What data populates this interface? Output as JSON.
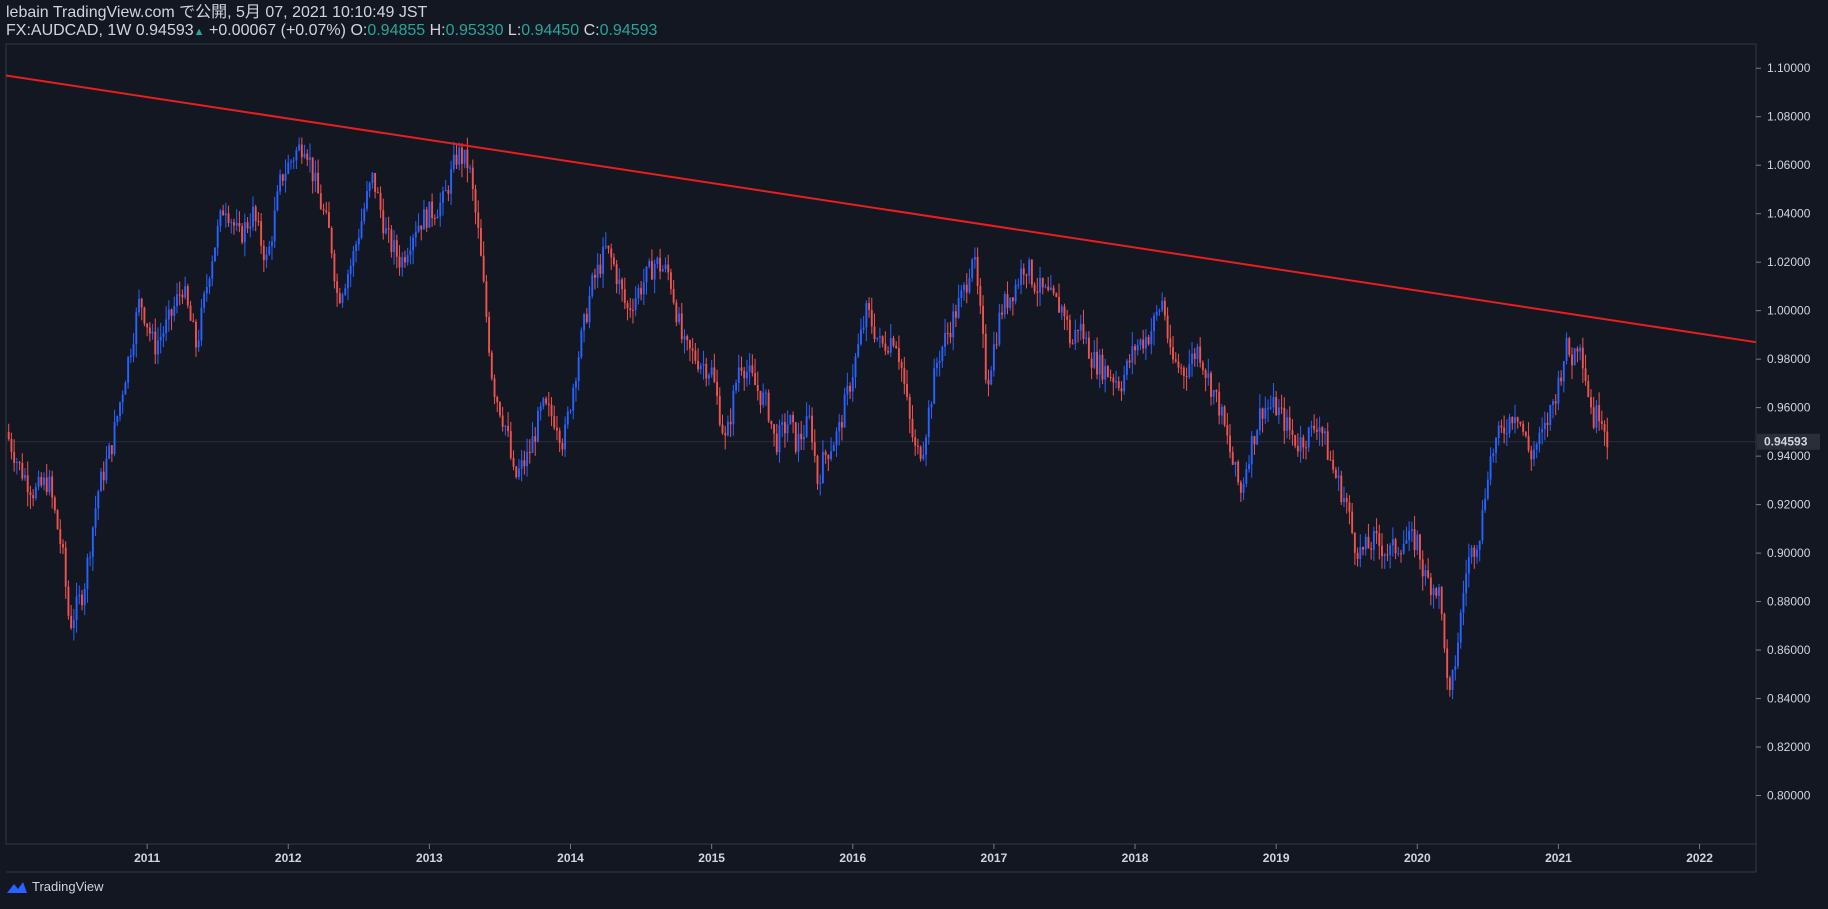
{
  "header": {
    "publisher": "lebain TradingView.com で公開, 5月 07, 2021 10:10:49 JST",
    "symbol": "FX:AUDCAD, 1W",
    "last": "0.94593",
    "arrow": "▲",
    "change": "+0.00067 (+0.07%)",
    "o_label": "O:",
    "o_value": "0.94855",
    "h_label": "H:",
    "h_value": "0.95330",
    "l_label": "L:",
    "l_value": "0.94450",
    "c_label": "C:",
    "c_value": "0.94593"
  },
  "footer": {
    "brand": "TradingView"
  },
  "colors": {
    "background": "#131722",
    "up": "#2962ff",
    "down": "#ef5350",
    "trendline": "#e91e1e",
    "grid": "#2a2e39",
    "text": "#d1d4dc"
  },
  "chart_data": {
    "type": "candlestick",
    "symbol": "FX:AUDCAD",
    "interval": "1W",
    "ylim": [
      0.78,
      1.11
    ],
    "yticks": [
      "1.10000",
      "1.08000",
      "1.06000",
      "1.04000",
      "1.02000",
      "1.00000",
      "0.98000",
      "0.96000",
      "0.94000",
      "0.92000",
      "0.90000",
      "0.88000",
      "0.86000",
      "0.84000",
      "0.82000",
      "0.80000"
    ],
    "ytick_values": [
      1.1,
      1.08,
      1.06,
      1.04,
      1.02,
      1.0,
      0.98,
      0.96,
      0.94,
      0.92,
      0.9,
      0.88,
      0.86,
      0.84,
      0.82,
      0.8
    ],
    "xlim": [
      2010.0,
      2022.4
    ],
    "xticks": [
      "2011",
      "2012",
      "2013",
      "2014",
      "2015",
      "2016",
      "2017",
      "2018",
      "2019",
      "2020",
      "2021",
      "2022"
    ],
    "xtick_values": [
      2011,
      2012,
      2013,
      2014,
      2015,
      2016,
      2017,
      2018,
      2019,
      2020,
      2021,
      2022
    ],
    "current_price": 0.94593,
    "current_price_label": "0.94593",
    "close_path": [
      [
        2010.0,
        0.95
      ],
      [
        2010.1,
        0.935
      ],
      [
        2010.2,
        0.925
      ],
      [
        2010.3,
        0.93
      ],
      [
        2010.4,
        0.9
      ],
      [
        2010.45,
        0.87
      ],
      [
        2010.55,
        0.885
      ],
      [
        2010.65,
        0.925
      ],
      [
        2010.75,
        0.945
      ],
      [
        2010.85,
        0.975
      ],
      [
        2010.95,
        1.005
      ],
      [
        2011.05,
        0.985
      ],
      [
        2011.15,
        0.995
      ],
      [
        2011.25,
        1.01
      ],
      [
        2011.35,
        0.985
      ],
      [
        2011.45,
        1.02
      ],
      [
        2011.55,
        1.045
      ],
      [
        2011.65,
        1.03
      ],
      [
        2011.75,
        1.04
      ],
      [
        2011.85,
        1.02
      ],
      [
        2011.95,
        1.055
      ],
      [
        2012.05,
        1.065
      ],
      [
        2012.12,
        1.07
      ],
      [
        2012.2,
        1.05
      ],
      [
        2012.3,
        1.03
      ],
      [
        2012.35,
        1.005
      ],
      [
        2012.45,
        1.02
      ],
      [
        2012.55,
        1.045
      ],
      [
        2012.6,
        1.055
      ],
      [
        2012.7,
        1.03
      ],
      [
        2012.8,
        1.02
      ],
      [
        2012.9,
        1.035
      ],
      [
        2013.0,
        1.04
      ],
      [
        2013.1,
        1.045
      ],
      [
        2013.2,
        1.065
      ],
      [
        2013.28,
        1.06
      ],
      [
        2013.35,
        1.03
      ],
      [
        2013.4,
        1.0
      ],
      [
        2013.45,
        0.97
      ],
      [
        2013.55,
        0.95
      ],
      [
        2013.6,
        0.93
      ],
      [
        2013.7,
        0.94
      ],
      [
        2013.8,
        0.96
      ],
      [
        2013.9,
        0.955
      ],
      [
        2013.95,
        0.945
      ],
      [
        2014.05,
        0.98
      ],
      [
        2014.15,
        1.01
      ],
      [
        2014.25,
        1.025
      ],
      [
        2014.3,
        1.02
      ],
      [
        2014.4,
        1.0
      ],
      [
        2014.5,
        1.01
      ],
      [
        2014.6,
        1.02
      ],
      [
        2014.7,
        1.015
      ],
      [
        2014.75,
        1.0
      ],
      [
        2014.8,
        0.985
      ],
      [
        2014.9,
        0.98
      ],
      [
        2015.0,
        0.975
      ],
      [
        2015.05,
        0.96
      ],
      [
        2015.1,
        0.945
      ],
      [
        2015.2,
        0.98
      ],
      [
        2015.3,
        0.97
      ],
      [
        2015.4,
        0.96
      ],
      [
        2015.45,
        0.945
      ],
      [
        2015.55,
        0.955
      ],
      [
        2015.6,
        0.945
      ],
      [
        2015.7,
        0.955
      ],
      [
        2015.75,
        0.93
      ],
      [
        2015.8,
        0.94
      ],
      [
        2015.9,
        0.95
      ],
      [
        2016.0,
        0.975
      ],
      [
        2016.1,
        1.0
      ],
      [
        2016.2,
        0.985
      ],
      [
        2016.3,
        0.99
      ],
      [
        2016.35,
        0.975
      ],
      [
        2016.4,
        0.955
      ],
      [
        2016.45,
        0.94
      ],
      [
        2016.5,
        0.945
      ],
      [
        2016.6,
        0.98
      ],
      [
        2016.7,
        0.995
      ],
      [
        2016.8,
        1.01
      ],
      [
        2016.85,
        1.025
      ],
      [
        2016.9,
        1.0
      ],
      [
        2016.95,
        0.97
      ],
      [
        2017.05,
        1.0
      ],
      [
        2017.15,
        1.01
      ],
      [
        2017.22,
        1.02
      ],
      [
        2017.3,
        1.01
      ],
      [
        2017.4,
        1.005
      ],
      [
        2017.5,
        1.0
      ],
      [
        2017.55,
        0.985
      ],
      [
        2017.6,
        0.995
      ],
      [
        2017.7,
        0.98
      ],
      [
        2017.8,
        0.975
      ],
      [
        2017.9,
        0.97
      ],
      [
        2018.0,
        0.985
      ],
      [
        2018.1,
        0.99
      ],
      [
        2018.2,
        1.005
      ],
      [
        2018.25,
        0.98
      ],
      [
        2018.35,
        0.975
      ],
      [
        2018.45,
        0.985
      ],
      [
        2018.5,
        0.975
      ],
      [
        2018.6,
        0.96
      ],
      [
        2018.7,
        0.935
      ],
      [
        2018.75,
        0.925
      ],
      [
        2018.8,
        0.94
      ],
      [
        2018.9,
        0.96
      ],
      [
        2019.0,
        0.96
      ],
      [
        2019.1,
        0.95
      ],
      [
        2019.15,
        0.945
      ],
      [
        2019.25,
        0.95
      ],
      [
        2019.3,
        0.955
      ],
      [
        2019.4,
        0.935
      ],
      [
        2019.5,
        0.92
      ],
      [
        2019.55,
        0.905
      ],
      [
        2019.6,
        0.9
      ],
      [
        2019.7,
        0.905
      ],
      [
        2019.8,
        0.9
      ],
      [
        2019.9,
        0.905
      ],
      [
        2020.0,
        0.905
      ],
      [
        2020.05,
        0.89
      ],
      [
        2020.15,
        0.885
      ],
      [
        2020.2,
        0.86
      ],
      [
        2020.22,
        0.835
      ],
      [
        2020.28,
        0.86
      ],
      [
        2020.35,
        0.895
      ],
      [
        2020.45,
        0.91
      ],
      [
        2020.5,
        0.935
      ],
      [
        2020.55,
        0.945
      ],
      [
        2020.65,
        0.955
      ],
      [
        2020.7,
        0.96
      ],
      [
        2020.75,
        0.95
      ],
      [
        2020.8,
        0.94
      ],
      [
        2020.9,
        0.95
      ],
      [
        2021.0,
        0.97
      ],
      [
        2021.05,
        0.985
      ],
      [
        2021.1,
        0.98
      ],
      [
        2021.15,
        0.99
      ],
      [
        2021.2,
        0.97
      ],
      [
        2021.25,
        0.955
      ],
      [
        2021.3,
        0.96
      ],
      [
        2021.35,
        0.946
      ]
    ],
    "trendline": {
      "start": [
        2010.0,
        1.097
      ],
      "end": [
        2022.4,
        0.987
      ]
    }
  }
}
